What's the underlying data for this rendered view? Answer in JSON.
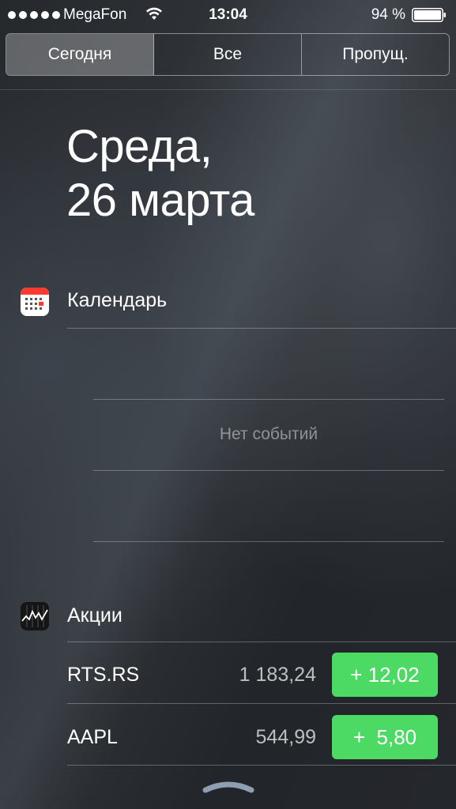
{
  "status_bar": {
    "carrier": "MegaFon",
    "time": "13:04",
    "battery": "94 %"
  },
  "tabs": [
    {
      "label": "Сегодня",
      "active": true
    },
    {
      "label": "Все",
      "active": false
    },
    {
      "label": "Пропущ.",
      "active": false
    }
  ],
  "date": {
    "line1": "Среда,",
    "line2": "26 марта"
  },
  "calendar": {
    "title": "Календарь",
    "icon": "calendar-icon",
    "empty_text": "Нет событий"
  },
  "stocks": {
    "title": "Акции",
    "icon": "stocks-icon",
    "rows": [
      {
        "symbol": "RTS.RS",
        "price": "1 183,24",
        "change": "+ 12,02"
      },
      {
        "symbol": "AAPL",
        "price": "544,99",
        "change": "+  5,80"
      }
    ],
    "change_color": "#4cd964"
  },
  "colors": {
    "accent_green": "#4cd964"
  }
}
